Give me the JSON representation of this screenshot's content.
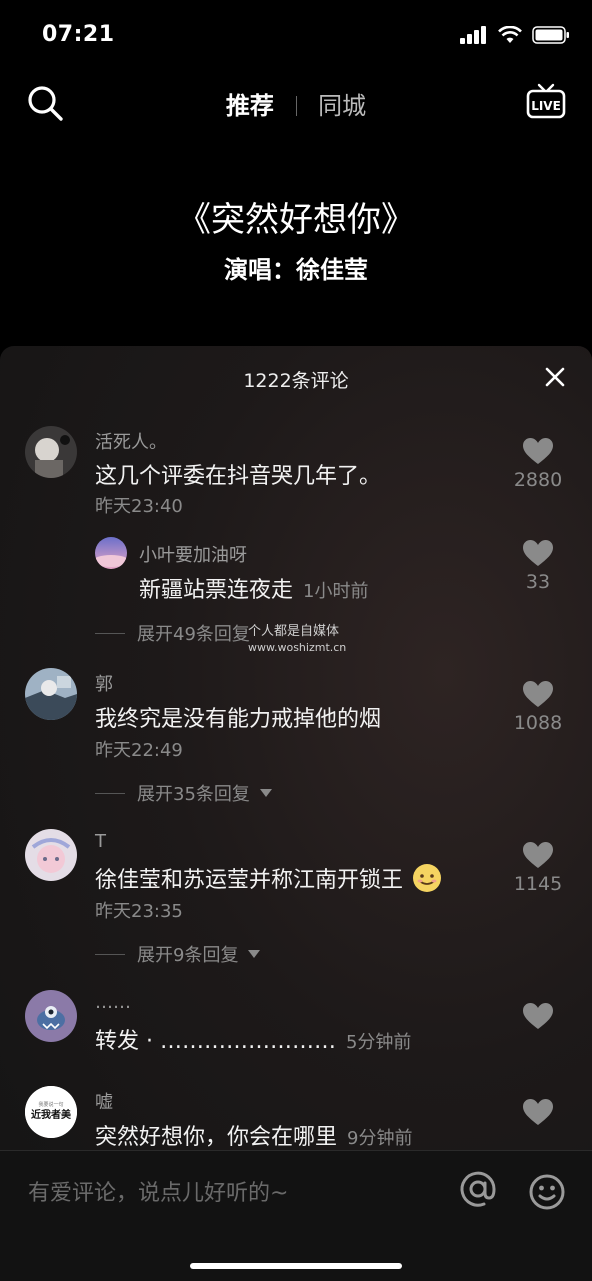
{
  "status_bar": {
    "time": "07:21"
  },
  "top_nav": {
    "tab_recommend": "推荐",
    "tab_local": "同城",
    "live_label": "LIVE"
  },
  "video": {
    "song_title": "《突然好想你》",
    "singer": "演唱：徐佳莹"
  },
  "comments_sheet": {
    "count_label": "1222条评论",
    "comments": [
      {
        "name": "活死人。",
        "text": "这几个评委在抖音哭几年了。",
        "time": "昨天23:40",
        "likes": "2880",
        "reply": {
          "name": "小叶要加油呀",
          "text": "新疆站票连夜走",
          "time": "1小时前",
          "likes": "33"
        },
        "expand": "展开49条回复"
      },
      {
        "name": "郭",
        "text": "我终究是没有能力戒掉他的烟",
        "time": "昨天22:49",
        "likes": "1088",
        "expand": "展开35条回复"
      },
      {
        "name": "T",
        "text": "徐佳莹和苏运莹并称江南开锁王",
        "time": "昨天23:35",
        "likes": "1145",
        "expand": "展开9条回复"
      },
      {
        "name": "……",
        "text": "转发 · ……………………",
        "time": "5分钟前"
      },
      {
        "name": "嘘",
        "text": "突然好想你，你会在哪里",
        "time": "9分钟前",
        "avatar_text": "近我者美",
        "avatar_small_text": "我要说一句"
      }
    ]
  },
  "watermark": {
    "line1": "个人都是自媒体",
    "line2": "www.woshizmt.cn"
  },
  "bottom_bar": {
    "placeholder": "有爱评论，说点儿好听的~"
  }
}
